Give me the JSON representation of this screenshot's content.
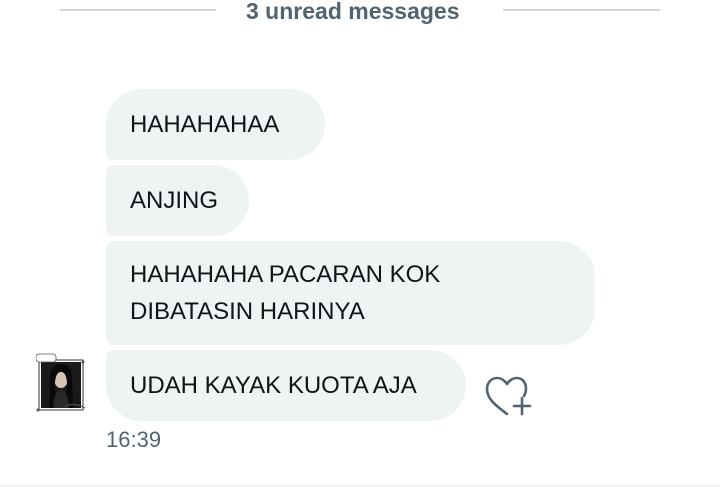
{
  "divider": {
    "label": "3 unread messages"
  },
  "messages": [
    {
      "text": "HAHAHAHAA"
    },
    {
      "text": "ANJING"
    },
    {
      "lines": [
        "HAHAHAHA PACARAN KOK",
        "DIBATASIN HARINYA"
      ]
    },
    {
      "text": "UDAH KAYAK KUOTA AJA"
    }
  ],
  "timestamp": "16:39",
  "icons": {
    "react": "heart-plus-icon",
    "avatar": "avatar"
  },
  "colors": {
    "bubble_bg": "#eff3f4",
    "text": "#0f1419",
    "secondary_text": "#536471",
    "divider": "#cfd9de"
  }
}
